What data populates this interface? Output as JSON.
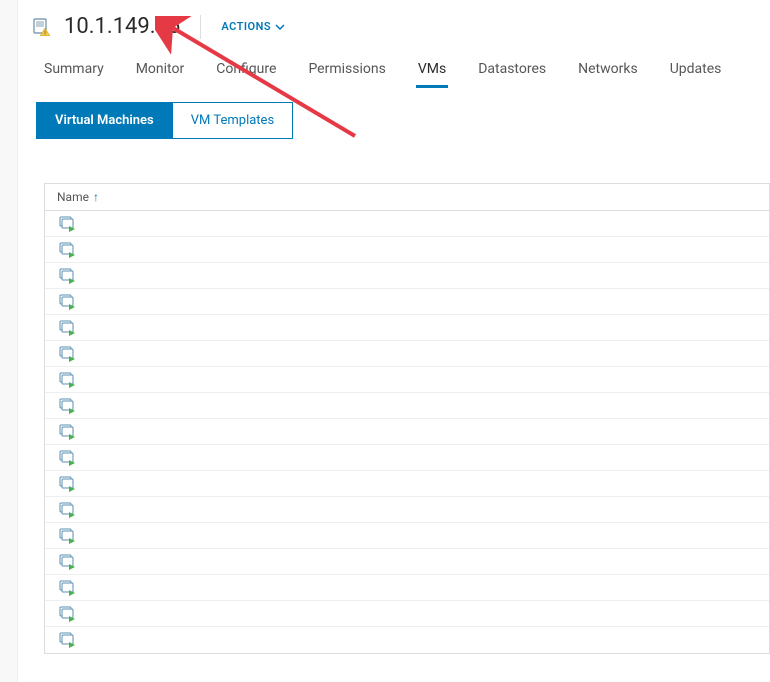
{
  "header": {
    "host_ip": "10.1.149.16",
    "actions_label": "ACTIONS"
  },
  "tabs": [
    {
      "label": "Summary",
      "active": false
    },
    {
      "label": "Monitor",
      "active": false
    },
    {
      "label": "Configure",
      "active": false
    },
    {
      "label": "Permissions",
      "active": false
    },
    {
      "label": "VMs",
      "active": true
    },
    {
      "label": "Datastores",
      "active": false
    },
    {
      "label": "Networks",
      "active": false
    },
    {
      "label": "Updates",
      "active": false
    }
  ],
  "subtabs": [
    {
      "label": "Virtual Machines",
      "active": true
    },
    {
      "label": "VM Templates",
      "active": false
    }
  ],
  "table": {
    "header": "Name",
    "sort_indicator": "↑",
    "rows": [
      {
        "name": ""
      },
      {
        "name": ""
      },
      {
        "name": ""
      },
      {
        "name": ""
      },
      {
        "name": ""
      },
      {
        "name": ""
      },
      {
        "name": ""
      },
      {
        "name": ""
      },
      {
        "name": ""
      },
      {
        "name": ""
      },
      {
        "name": ""
      },
      {
        "name": ""
      },
      {
        "name": ""
      },
      {
        "name": ""
      },
      {
        "name": ""
      },
      {
        "name": ""
      },
      {
        "name": ""
      }
    ]
  },
  "colors": {
    "accent": "#0079b8",
    "arrow": "#e63946"
  }
}
